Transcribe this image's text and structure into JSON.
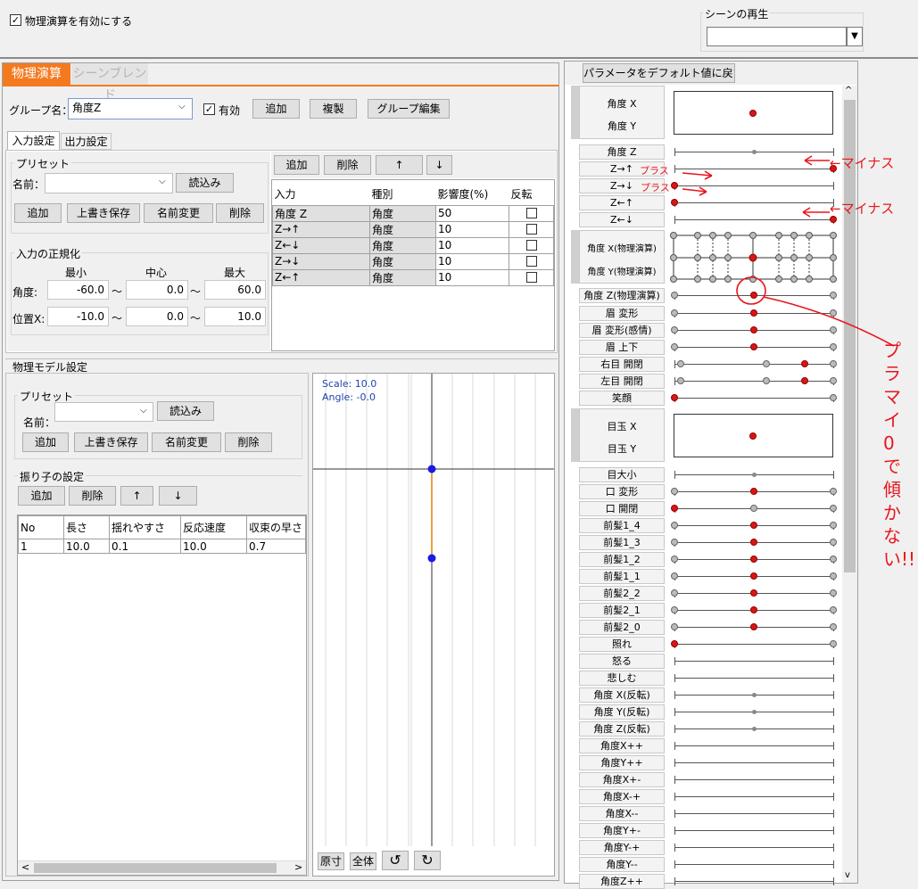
{
  "top": {
    "physics_enable_label": "物理演算を有効にする",
    "scene_play_label": "シーンの再生"
  },
  "tabs": {
    "physics": "物理演算",
    "scene_blend": "シーンブレンド"
  },
  "group": {
    "label": "グループ名：",
    "value": "角度Z",
    "enabled_label": "有効",
    "add": "追加",
    "duplicate": "複製",
    "edit": "グループ編集"
  },
  "subtabs": {
    "input": "入力設定",
    "output": "出力設定"
  },
  "input_preset": {
    "title": "プリセット",
    "name_label": "名前：",
    "load": "読込み",
    "add": "追加",
    "overwrite": "上書き保存",
    "rename": "名前変更",
    "delete": "削除"
  },
  "normalize": {
    "title": "入力の正規化",
    "min": "最小",
    "center": "中心",
    "max": "最大",
    "angle_label": "角度:",
    "pos_label": "位置X:",
    "angle_vals": [
      "-60.0",
      "0.0",
      "60.0"
    ],
    "pos_vals": [
      "-10.0",
      "0.0",
      "10.0"
    ],
    "tilde": "～"
  },
  "input_table": {
    "buttons": {
      "add": "追加",
      "delete": "削除",
      "up": "↑",
      "down": "↓"
    },
    "headers": [
      "入力",
      "種別",
      "影響度(%)",
      "反転"
    ],
    "rows": [
      {
        "input": "角度 Z",
        "type": "角度",
        "influence": "50"
      },
      {
        "input": "Z→↑",
        "type": "角度",
        "influence": "10"
      },
      {
        "input": "Z←↓",
        "type": "角度",
        "influence": "10"
      },
      {
        "input": "Z→↓",
        "type": "角度",
        "influence": "10"
      },
      {
        "input": "Z←↑",
        "type": "角度",
        "influence": "10"
      }
    ]
  },
  "model": {
    "title": "物理モデル設定",
    "preset_title": "プリセット",
    "name_label": "名前：",
    "load": "読込み",
    "add": "追加",
    "overwrite": "上書き保存",
    "rename": "名前変更",
    "delete": "削除",
    "pendulum_title": "振り子の設定",
    "p_add": "追加",
    "p_delete": "削除",
    "p_up": "↑",
    "p_down": "↓",
    "headers": [
      "No",
      "長さ",
      "揺れやすさ",
      "反応速度",
      "収束の早さ"
    ],
    "row": [
      "1",
      "10.0",
      "0.1",
      "10.0",
      "0.7"
    ]
  },
  "preview": {
    "scale": "Scale: 10.0",
    "angle": "Angle: -0.0",
    "reset": "原寸",
    "fit": "全体",
    "undo": "↺",
    "redo": "↻"
  },
  "right": {
    "reset_button": "パラメータをデフォルト値に戻す",
    "xy1": [
      "角度 X",
      "角度 Y"
    ],
    "xy2": [
      "角度 X(物理演算)",
      "角度 Y(物理演算)"
    ],
    "xy3": [
      "目玉 X",
      "目玉 Y"
    ],
    "params": [
      "角度 Z",
      "Z→↑",
      "Z→↓",
      "Z←↑",
      "Z←↓",
      "角度 Z(物理演算)",
      "眉 変形",
      "眉 変形(感情)",
      "眉 上下",
      "右目 開閉",
      "左目 開閉",
      "笑顔",
      "目大小",
      "口 変形",
      "口 開閉",
      "前髪1_4",
      "前髪1_3",
      "前髪1_2",
      "前髪1_1",
      "前髪2_2",
      "前髪2_1",
      "前髪2_0",
      "照れ",
      "怒る",
      "悲しむ",
      "角度 X(反転)",
      "角度 Y(反転)",
      "角度 Z(反転)",
      "角度X++",
      "角度Y++",
      "角度X+-",
      "角度X-+",
      "角度X--",
      "角度Y+-",
      "角度Y-+",
      "角度Y--",
      "角度Z++"
    ]
  },
  "annotations": {
    "minus1": "←マイナス",
    "plus1": "プラス",
    "plus2": "プラス",
    "minus2": "←マイナス",
    "note": "プラマイ0で傾かない!!"
  },
  "colors": {
    "accent": "#f47a20",
    "red_dot": "#d41818",
    "annotation": "#e8161c"
  }
}
